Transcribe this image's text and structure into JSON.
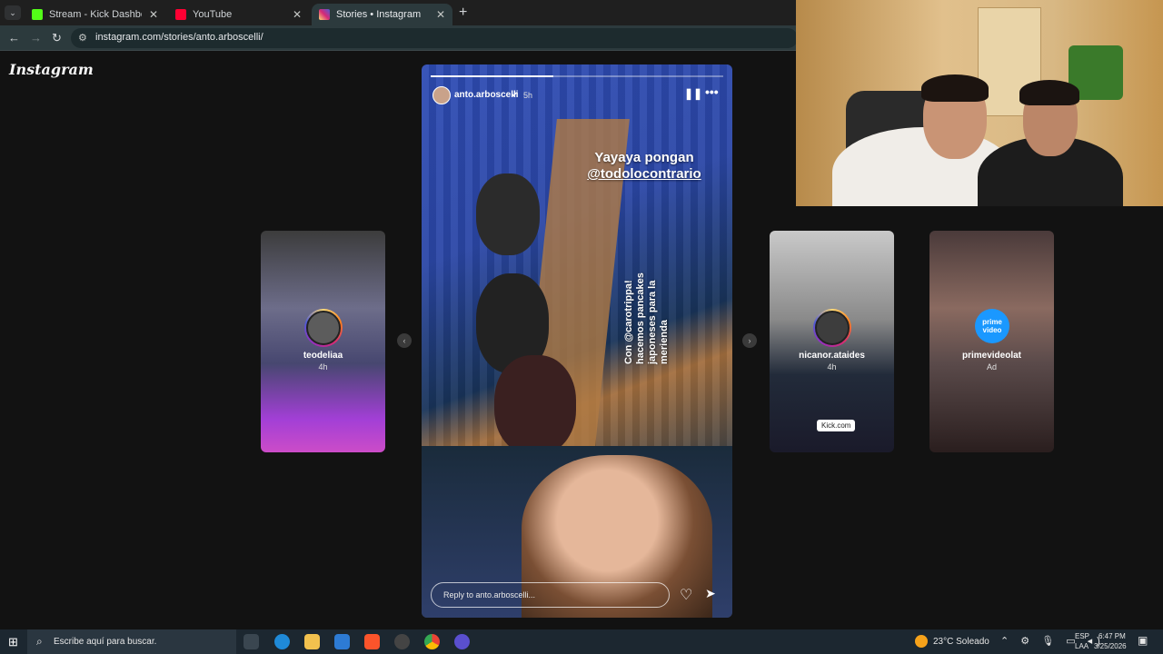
{
  "browser": {
    "tabs": [
      {
        "label": "Stream - Kick Dashboard",
        "close": "✕",
        "favicon_color": "#53fc18"
      },
      {
        "label": "YouTube",
        "close": "✕",
        "favicon_color": "#ff0033"
      },
      {
        "label": "Stories • Instagram",
        "close": "✕",
        "favicon_color": "#e1306c"
      }
    ],
    "new_tab": "+",
    "tab_search": "⌄",
    "back": "←",
    "forward": "→",
    "reload": "↻",
    "url": "instagram.com/stories/anto.arboscelli/",
    "site_info": "⚙"
  },
  "instagram": {
    "logo": "Instagram",
    "story": {
      "username": "anto.arboscelli",
      "time": "5h",
      "verified_icon": "✔",
      "pause_icon": "❚❚",
      "more_icon": "•••",
      "progress": 0.42,
      "text_line1": "Yayaya pongan",
      "text_line2": "@todolocontrario",
      "rotated_line1": "Con @carotrippa!",
      "rotated_line2": "hacemos pancakes",
      "rotated_line3": "japoneses para la",
      "rotated_line4": "merienda",
      "reply_placeholder": "Reply to anto.arboscelli...",
      "heart_icon": "♡",
      "send_icon": "➤"
    },
    "side_stories": [
      {
        "username": "teodeliaa",
        "time": "4h"
      },
      {
        "username": "nicanor.ataides",
        "time": "4h"
      },
      {
        "username": "primevideolat",
        "time": "Ad",
        "brand_label": "prime video"
      }
    ],
    "prev_arrow": "‹",
    "next_arrow": "›",
    "kick_tag": "Kick.com"
  },
  "taskbar": {
    "start_icon": "⊞",
    "search_placeholder": "Escribe aquí para buscar.",
    "weather": "23°C  Soleado",
    "tray_icons": "⌃ ⚙ 🎙 ▭ ◂)",
    "lang1": "ESP",
    "lang2": "LAA",
    "time": "6:47 PM",
    "date": "3/25/2026",
    "notifications_icon": "▣"
  }
}
